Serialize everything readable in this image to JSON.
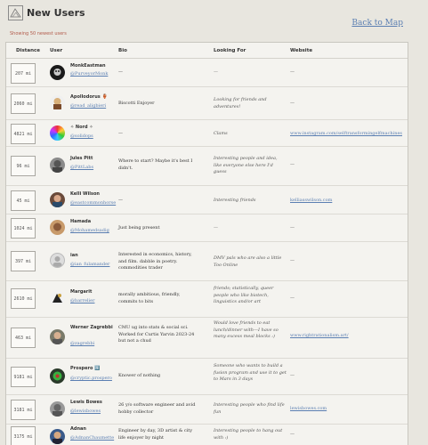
{
  "header": {
    "title": "New Users",
    "back_link": "Back to Map",
    "showing": "Showing 50 newest users"
  },
  "columns": {
    "distance": "Distance",
    "user": "User",
    "bio": "Bio",
    "looking": "Looking For",
    "website": "Website"
  },
  "rows": [
    {
      "distance": "207 mi",
      "name": "MonkEastman",
      "handle": "@PurveyorMonk",
      "bio": "—",
      "looking": "—",
      "website": "—"
    },
    {
      "distance": "2060 mi",
      "name": "Apollodorus 🏺",
      "handle": "@read_aligbieri",
      "bio": "Biscotti Enjoyer",
      "looking": "Looking for friends and adventures!",
      "website": "—"
    },
    {
      "distance": "4821 mi",
      "name": "✧ Nord ✧",
      "handle": "@solidops",
      "bio": "—",
      "looking": "Clams",
      "website": "www.instagram.com/selftransformingelfmachines"
    },
    {
      "distance": "96 mi",
      "name": "Jules Pitt",
      "handle": "@PittLabs",
      "bio": "Where to start? Maybe it's best I didn't.",
      "looking": "Interesting people and idea, like everyone else here I'd guess",
      "website": "—"
    },
    {
      "distance": "45 mi",
      "name": "Kelli Wilson",
      "handle": "@eastcommonhorse",
      "bio": "—",
      "looking": "Interesting friends",
      "website": "kelliasswilson.com"
    },
    {
      "distance": "1024 mi",
      "name": "Hamada",
      "handle": "@Mohamedsadig",
      "bio": "Just being present",
      "looking": "—",
      "website": "—"
    },
    {
      "distance": "397 mi",
      "name": "ian",
      "handle": "@ian_fulamander",
      "bio": "Interested in economics, history, and film. dabble in poetry. commodities trader",
      "looking": "DMV pals who are also a little Too Online",
      "website": "—"
    },
    {
      "distance": "2610 mi",
      "name": "Margarit",
      "handle": "@barrelier",
      "bio": "morally ambitious, friendly, commits to bits",
      "looking": "friends; statistically, queer people who like biotech, linguistics and/or art",
      "website": "—"
    },
    {
      "distance": "463 mi",
      "name": "Werner Zagrebbi",
      "handle": "@zagrebbi",
      "bio": "CMU ug into stats & social sci. Worked for Curtis Yarvin 2023-24 but not a chud",
      "looking": "Would love friends to eat lunch/dinner with—I have so many excess meal blocks :)",
      "website": "www.rightrationalism.art/"
    },
    {
      "distance": "9181 mi",
      "name": "Prospero 1️⃣",
      "handle": "@cryptic.prospero",
      "bio": "Knower of nothing",
      "looking": "Someone who wants to build a fusion program and use it to get to Mars in 3 days",
      "website": "—"
    },
    {
      "distance": "3181 mi",
      "name": "Lewis Bowes",
      "handle": "@lewisbowes",
      "bio": "26 y/o software engineer and avid hobby collector",
      "looking": "Interesting people who find life fun",
      "website": "lewisbowes.com"
    },
    {
      "distance": "3175 mi",
      "name": "Adnan",
      "handle": "@AdnanChaumette",
      "bio": "Engineer by day, 3D artist & city life enjoyer by night",
      "looking": "Interesting people to hang out with :)",
      "website": "—"
    }
  ]
}
